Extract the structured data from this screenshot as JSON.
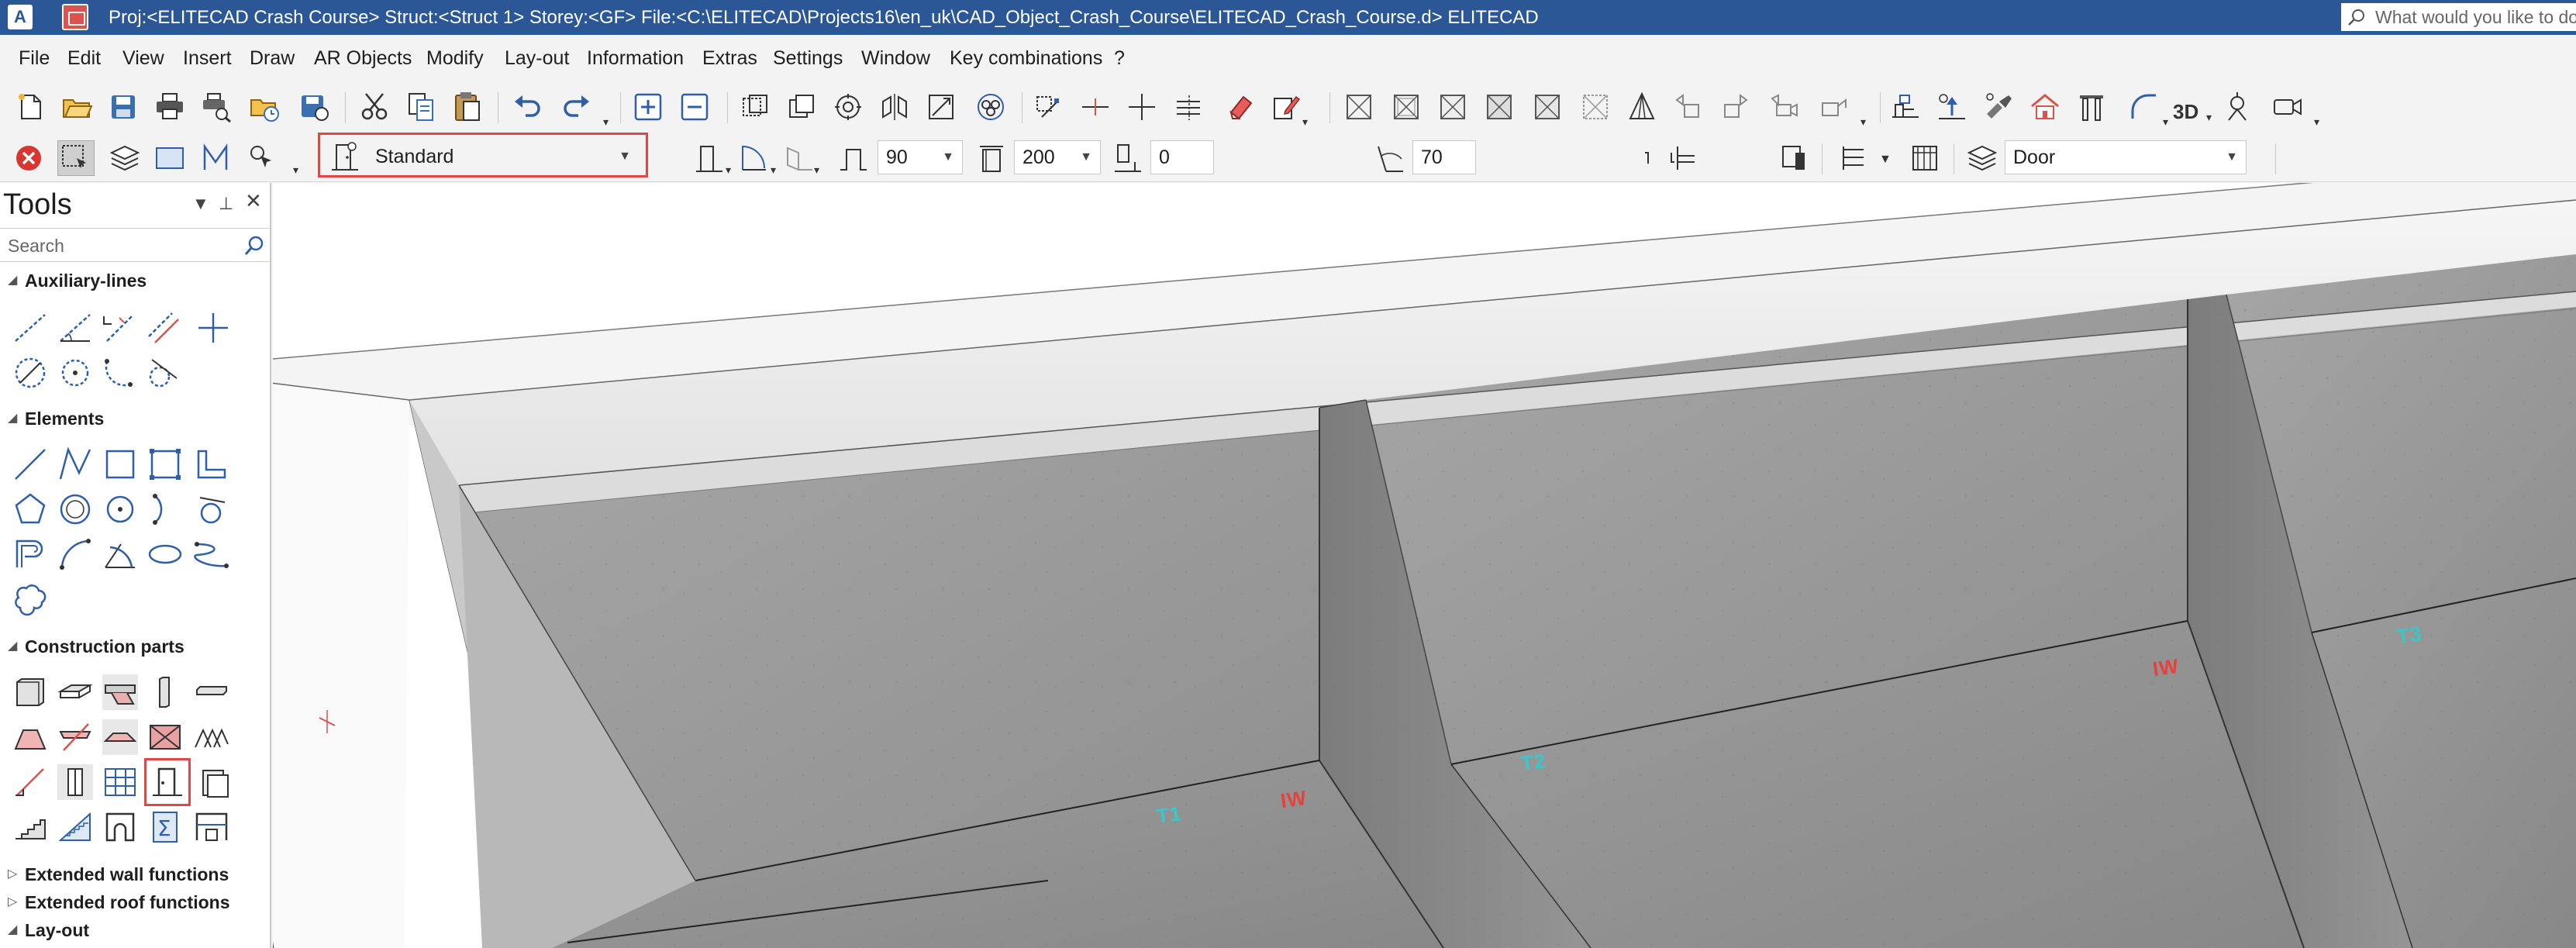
{
  "window": {
    "title": "Proj:<ELITECAD Crash Course> Struct:<Struct 1>  Storey:<GF>  File:<C:\\ELITECAD\\Projects16\\en_uk\\CAD_Object_Crash_Course\\ELITECAD_Crash_Course.d> ELITECAD",
    "app_icon_letter": "A",
    "tell_me_placeholder": "What would you like to do"
  },
  "menu": {
    "items": [
      "File",
      "Edit",
      "View",
      "Insert",
      "Draw",
      "AR Objects",
      "Modify",
      "Lay-out",
      "Information",
      "Extras",
      "Settings",
      "Window",
      "Key combinations",
      "?"
    ]
  },
  "toolbar2": {
    "style_combo": "Standard",
    "width_value": "90",
    "height_value": "200",
    "parapet_value": "0",
    "angle_value": "70",
    "layer_combo": "Door"
  },
  "tools_panel": {
    "title": "Tools",
    "search_placeholder": "Search",
    "sections": {
      "auxiliary": "Auxiliary-lines",
      "elements": "Elements",
      "construction": "Construction parts",
      "ext_wall": "Extended wall functions",
      "ext_roof": "Extended roof functions",
      "layout": "Lay-out"
    }
  },
  "viewport": {
    "labels": {
      "iw_left": "IW",
      "iw_right": "IW",
      "t1": "T1",
      "t2": "T2",
      "t3": "T3"
    },
    "colors": {
      "wall_label": "#e8403a",
      "room_label": "#37c8cc"
    }
  },
  "colors": {
    "titlebar": "#2b5797",
    "highlight": "#e04848"
  }
}
